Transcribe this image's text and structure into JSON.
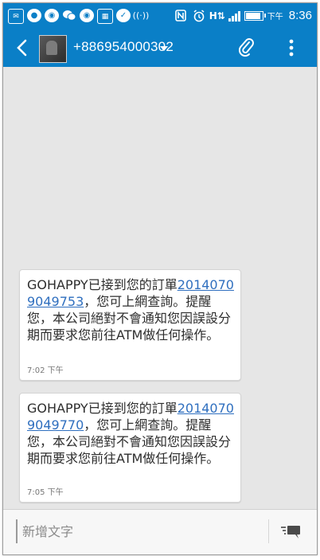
{
  "status_bar": {
    "icons": [
      "message-icon",
      "line-icon",
      "weibo-icon",
      "wechat-icon",
      "weibo-icon",
      "keyboard-icon",
      "dropbox-icon",
      "wifi-hotspot-icon",
      "nfc-icon",
      "alarm-icon",
      "h-data-icon",
      "signal-icon",
      "battery-icon"
    ],
    "ampm": "下午",
    "time": "8:36",
    "battery_level": 0.85,
    "color": "#0a7fc7"
  },
  "action_bar": {
    "contact": "+886954000302",
    "icons": [
      "back-icon",
      "dropdown-icon",
      "attach-icon",
      "more-icon"
    ]
  },
  "messages": [
    {
      "prefix": "GOHAPPY已接到您的訂單",
      "order_link": "20140709049753",
      "suffix": "，您可上網查詢。提醒您，本公司絕對不會通知您因誤設分期而要求您前往ATM做任何操作。",
      "time": "7:02 下午"
    },
    {
      "prefix": "GOHAPPY已接到您的訂單",
      "order_link": "20140709049770",
      "suffix": "，您可上網查詢。提醒您，本公司絕對不會通知您因誤設分期而要求您前往ATM做任何操作。",
      "time": "7:05 下午"
    }
  ],
  "composer": {
    "placeholder": "新增文字",
    "icons": [
      "send-icon"
    ]
  }
}
